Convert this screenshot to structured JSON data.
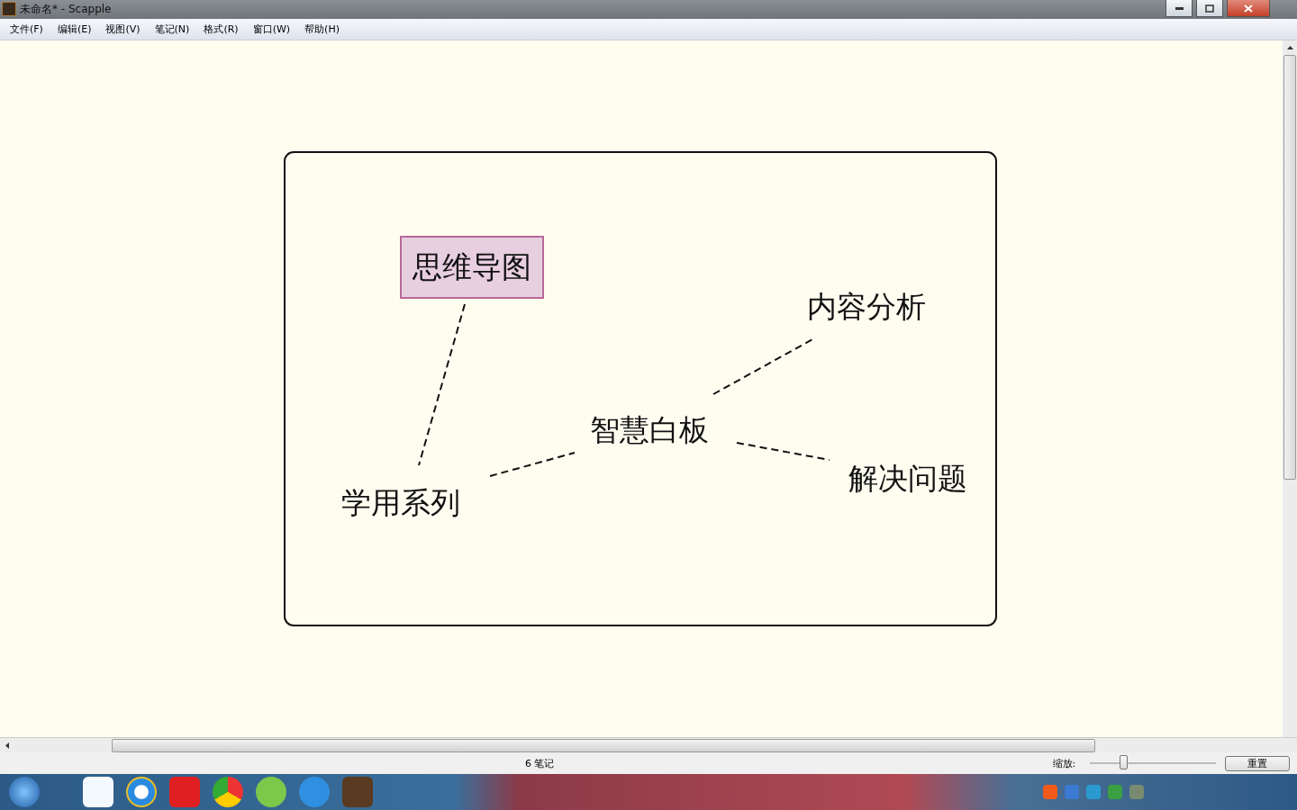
{
  "window": {
    "title": "未命名* - Scapple"
  },
  "menu": [
    {
      "label": "文件(F)"
    },
    {
      "label": "编辑(E)"
    },
    {
      "label": "视图(V)"
    },
    {
      "label": "笔记(N)"
    },
    {
      "label": "格式(R)"
    },
    {
      "label": "窗口(W)"
    },
    {
      "label": "帮助(H)"
    }
  ],
  "notes": [
    {
      "text": "思维导图",
      "kind": "boxed"
    },
    {
      "text": "内容分析",
      "kind": "plain"
    },
    {
      "text": "智慧白板",
      "kind": "plain"
    },
    {
      "text": "解决问题",
      "kind": "plain"
    },
    {
      "text": "学用系列",
      "kind": "plain"
    }
  ],
  "status_bar": {
    "note_count": "6 笔记",
    "zoom_label": "缩放:",
    "zoom": {
      "level": 0.25
    },
    "reset_button": "重置"
  }
}
